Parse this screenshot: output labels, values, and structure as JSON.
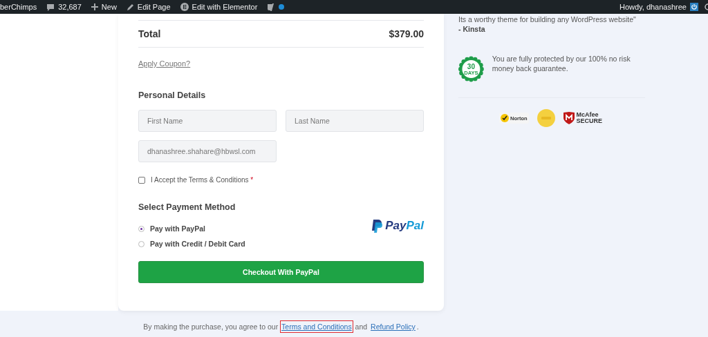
{
  "admin_bar": {
    "site": "berChimps",
    "comments": "32,687",
    "new": "New",
    "edit_page": "Edit Page",
    "elementor": "Edit with Elementor",
    "greeting": "Howdy, dhanashree"
  },
  "order": {
    "total_label": "Total",
    "total_value": "$379.00",
    "coupon_link": "Apply Coupon?"
  },
  "personal_details": {
    "heading": "Personal Details",
    "fields": [
      {
        "placeholder": "First Name"
      },
      {
        "placeholder": "Last Name"
      },
      {
        "placeholder": "dhanashree.shahare@hbwsl.com"
      }
    ],
    "terms": {
      "label": "I Accept the Terms & Conditions",
      "required": "*",
      "checked": false
    }
  },
  "payment": {
    "heading": "Select Payment Method",
    "logo": {
      "first": "Pay",
      "second": "Pal"
    },
    "options": [
      {
        "label": "Pay with PayPal",
        "selected": true
      },
      {
        "label": "Pay with Credit / Debit Card",
        "selected": false
      }
    ],
    "button": "Checkout With PayPal"
  },
  "footer": {
    "text": "By making the purchase, you agree to our",
    "links": [
      {
        "label": "Terms and Conditions",
        "highlighted": true
      },
      {
        "label": "Refund Policy",
        "highlighted": false
      }
    ],
    "joiner": "and",
    "end": "."
  },
  "sidebar": {
    "quote": "Its a worthy theme for building any WordPress website\"",
    "author": "- Kinsta",
    "seal": {
      "number": "30",
      "unit": "DAYS"
    },
    "guarantee": "You are fully protected by our 100% no risk money back guarantee.",
    "badges": {
      "norton": "Norton",
      "mcafee": "McAfee",
      "mcafee_sub": "SECURE"
    }
  }
}
